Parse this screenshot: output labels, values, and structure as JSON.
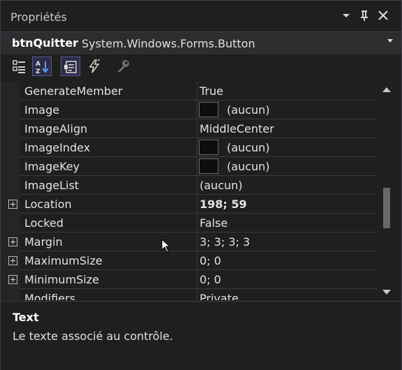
{
  "panel": {
    "title": "Propriétés"
  },
  "object_selector": {
    "name": "btnQuitter",
    "type": "System.Windows.Forms.Button"
  },
  "toolbar": {
    "buttons": [
      {
        "icon": "categorized-icon",
        "active": false
      },
      {
        "icon": "alphabetical-sort-icon",
        "active": true
      },
      {
        "icon": "properties-icon",
        "active": true
      },
      {
        "icon": "events-lightning-icon",
        "active": false
      },
      {
        "icon": "property-pages-wrench-icon",
        "active": false
      }
    ]
  },
  "properties": [
    {
      "name": "GenerateMember",
      "value": "True"
    },
    {
      "name": "Image",
      "value": "(aucun)",
      "swatch": true
    },
    {
      "name": "ImageAlign",
      "value": "MiddleCenter"
    },
    {
      "name": "ImageIndex",
      "value": "(aucun)",
      "swatch": true
    },
    {
      "name": "ImageKey",
      "value": "(aucun)",
      "swatch": true
    },
    {
      "name": "ImageList",
      "value": "(aucun)"
    },
    {
      "name": "Location",
      "value": "198; 59",
      "expandable": true,
      "bold": true
    },
    {
      "name": "Locked",
      "value": "False"
    },
    {
      "name": "Margin",
      "value": "3; 3; 3; 3",
      "expandable": true
    },
    {
      "name": "MaximumSize",
      "value": "0; 0",
      "expandable": true
    },
    {
      "name": "MinimumSize",
      "value": "0; 0",
      "expandable": true
    },
    {
      "name": "Modifiers",
      "value": "Private"
    }
  ],
  "description": {
    "title": "Text",
    "text": "Le texte associé au contrôle."
  },
  "colors": {
    "background": "#1f1f1f",
    "header_bar": "#2d2d30",
    "active_tool": "#2c2c46",
    "scroll_thumb": "#686868"
  }
}
